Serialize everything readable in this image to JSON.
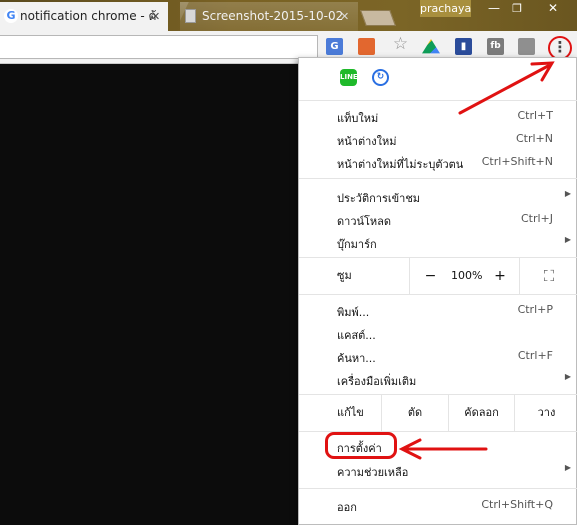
{
  "tabs": [
    {
      "title": "notification chrome - ต้",
      "favicon": "G",
      "close": "✕",
      "active": true
    },
    {
      "title": "Screenshot-2015-10-02",
      "close": "✕",
      "active": false
    }
  ],
  "profile_name": "prachaya",
  "window_controls": {
    "minimize": "—",
    "maximize": "❐",
    "close": "✕"
  },
  "toolbar": {
    "icons": [
      "translate-icon",
      "office-icon",
      "bookmark-star-icon",
      "drive-icon",
      "keep-icon",
      "facebook-icon",
      "calendar-icon",
      "menu-icon"
    ],
    "fb_label": "fb",
    "menu_glyph": "⋮"
  },
  "menu": {
    "extension_icons": {
      "line": "LINE",
      "sync": "↻"
    },
    "items": [
      {
        "label": "แท็บใหม่",
        "accel": "Ctrl+T"
      },
      {
        "label": "หน้าต่างใหม่",
        "accel": "Ctrl+N"
      },
      {
        "label": "หน้าต่างใหม่ที่ไม่ระบุตัวตน",
        "accel": "Ctrl+Shift+N"
      },
      {
        "label": "ประวัติการเข้าชม",
        "submenu": true
      },
      {
        "label": "ดาวน์โหลด",
        "accel": "Ctrl+J"
      },
      {
        "label": "บุ๊กมาร์ก",
        "submenu": true
      },
      {
        "label": "พิมพ์...",
        "accel": "Ctrl+P"
      },
      {
        "label": "แคสต์..."
      },
      {
        "label": "ค้นหา...",
        "accel": "Ctrl+F"
      },
      {
        "label": "เครื่องมือเพิ่มเติม",
        "submenu": true
      },
      {
        "label": "การตั้งค่า"
      },
      {
        "label": "ความช่วยเหลือ",
        "submenu": true
      },
      {
        "label": "ออก",
        "accel": "Ctrl+Shift+Q"
      }
    ],
    "zoom": {
      "label": "ซูม",
      "minus": "−",
      "value": "100%",
      "plus": "+",
      "fullscreen": "⛶"
    },
    "edit": {
      "label": "แก้ไข",
      "cut": "ตัด",
      "copy": "คัดลอก",
      "paste": "วาง"
    },
    "submenu_arrow": "▶"
  },
  "colors": {
    "annotation": "#e01212"
  }
}
